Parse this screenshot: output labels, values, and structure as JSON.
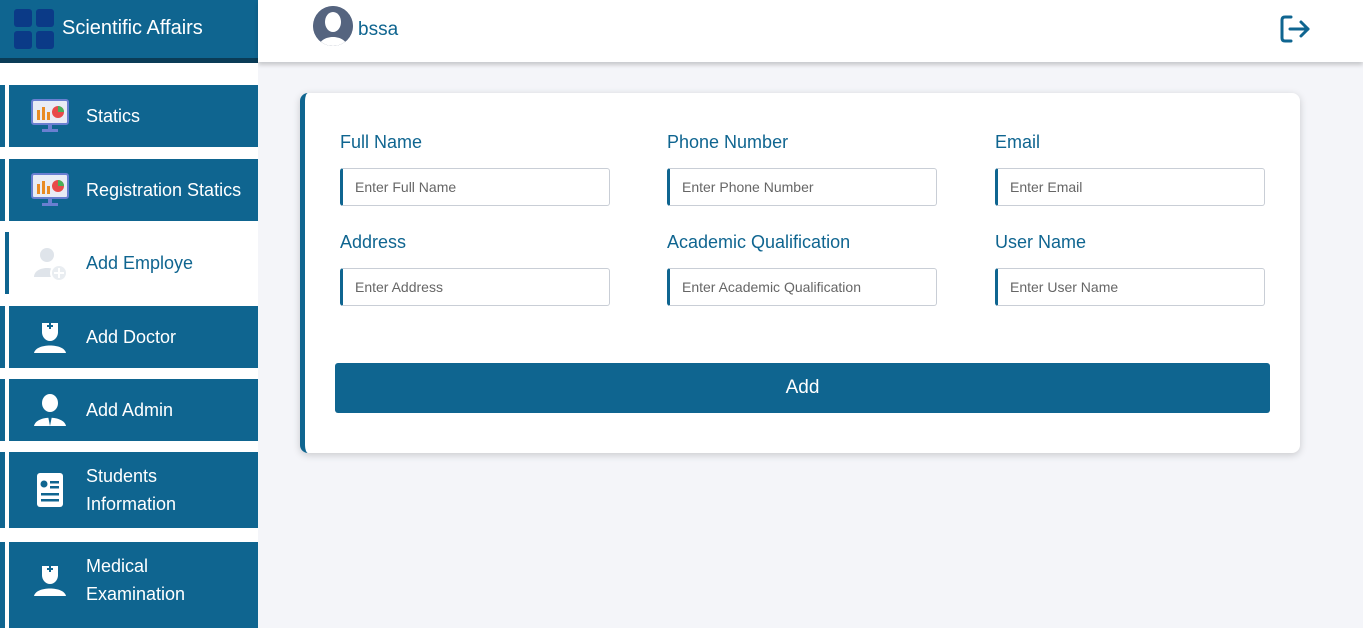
{
  "app": {
    "title": "Scientific Affairs"
  },
  "user": {
    "name": "bssa"
  },
  "sidebar": {
    "items": [
      {
        "label": "Statics",
        "icon": "chart-monitor-icon"
      },
      {
        "label": "Registration Statics",
        "icon": "chart-monitor-icon"
      },
      {
        "label": "Add Employe",
        "icon": "add-user-icon",
        "active": true
      },
      {
        "label": "Add Doctor",
        "icon": "doctor-icon"
      },
      {
        "label": "Add Admin",
        "icon": "admin-icon"
      },
      {
        "label": "Students Information",
        "label_line1": "Students",
        "label_line2": "Information",
        "icon": "id-card-icon"
      },
      {
        "label": "Medical Examination",
        "label_line1": "Medical",
        "label_line2": "Examination",
        "icon": "doctor-icon"
      }
    ]
  },
  "form": {
    "fields": [
      {
        "label": "Full Name",
        "placeholder": "Enter Full Name",
        "value": ""
      },
      {
        "label": "Phone Number",
        "placeholder": "Enter Phone Number",
        "value": ""
      },
      {
        "label": "Email",
        "placeholder": "Enter Email",
        "value": ""
      },
      {
        "label": "Address",
        "placeholder": "Enter Address",
        "value": ""
      },
      {
        "label": "Academic Qualification",
        "placeholder": "Enter Academic Qualification",
        "value": ""
      },
      {
        "label": "User Name",
        "placeholder": "Enter User Name",
        "value": ""
      }
    ],
    "submit_label": "Add"
  },
  "colors": {
    "primary": "#0f6590",
    "background": "#f4f5f9",
    "logo": "#0b3a87"
  }
}
